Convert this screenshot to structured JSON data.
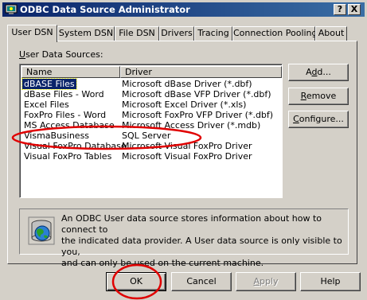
{
  "window": {
    "title": "ODBC Data Source Administrator",
    "help_button": "?",
    "close_button": "X"
  },
  "tabs": [
    {
      "label": "User DSN",
      "active": true
    },
    {
      "label": "System DSN",
      "active": false
    },
    {
      "label": "File DSN",
      "active": false
    },
    {
      "label": "Drivers",
      "active": false
    },
    {
      "label": "Tracing",
      "active": false
    },
    {
      "label": "Connection Pooling",
      "active": false
    },
    {
      "label": "About",
      "active": false
    }
  ],
  "user_data_sources": {
    "label_prefix": "",
    "label_accel": "U",
    "label_rest": "ser Data Sources:",
    "columns": [
      "Name",
      "Driver"
    ],
    "rows": [
      {
        "name": "dBASE Files",
        "driver": "Microsoft dBase Driver (*.dbf)",
        "selected": true
      },
      {
        "name": "dBase Files - Word",
        "driver": "Microsoft dBase VFP Driver (*.dbf)",
        "selected": false
      },
      {
        "name": "Excel Files",
        "driver": "Microsoft Excel Driver (*.xls)",
        "selected": false
      },
      {
        "name": "FoxPro Files - Word",
        "driver": "Microsoft FoxPro VFP Driver (*.dbf)",
        "selected": false
      },
      {
        "name": "MS Access Database",
        "driver": "Microsoft Access Driver (*.mdb)",
        "selected": false
      },
      {
        "name": "VismaBusiness",
        "driver": "SQL Server",
        "selected": false
      },
      {
        "name": "Visual FoxPro Database",
        "driver": "Microsoft Visual FoxPro Driver",
        "selected": false
      },
      {
        "name": "Visual FoxPro Tables",
        "driver": "Microsoft Visual FoxPro Driver",
        "selected": false
      }
    ]
  },
  "side_buttons": {
    "add": {
      "pre": "A",
      "accel": "d",
      "post": "d..."
    },
    "remove": {
      "pre": "",
      "accel": "R",
      "post": "emove"
    },
    "configure": {
      "pre": "",
      "accel": "C",
      "post": "onfigure..."
    }
  },
  "info": {
    "line1": "An ODBC User data source stores information about how to connect to",
    "line2": "the indicated data provider.   A User data source is only visible to you,",
    "line3": "and can only be used on the current machine."
  },
  "footer_buttons": {
    "ok": "OK",
    "cancel": "Cancel",
    "apply": {
      "accel": "A",
      "post": "pply"
    },
    "help": "Help"
  },
  "colors": {
    "annotation_red": "#e00000",
    "selection": "#0a246a",
    "face": "#d4d0c8"
  }
}
